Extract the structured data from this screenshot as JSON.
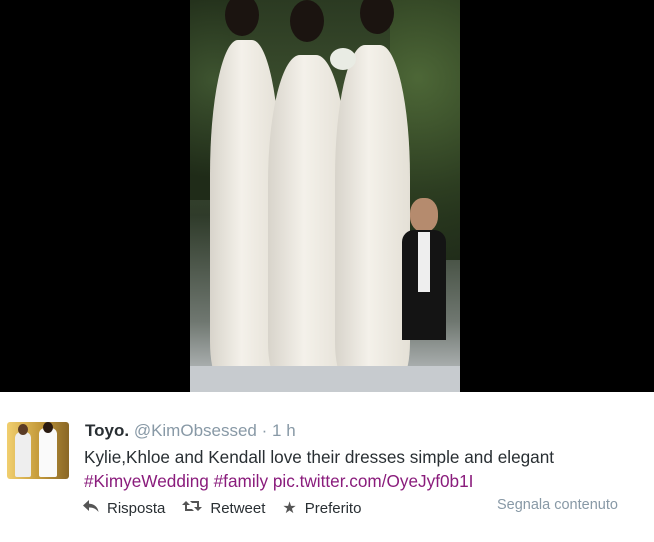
{
  "tweet": {
    "display_name": "Toyo.",
    "handle": "@KimObsessed",
    "separator": "·",
    "time": "1 h",
    "text": "Kylie,Khloe and Kendall love their dresses simple and elegant",
    "hashtags": [
      "#KimyeWedding",
      "#family"
    ],
    "link": "pic.twitter.com/OyeJyf0b1I",
    "actions": {
      "reply": "Risposta",
      "retweet": "Retweet",
      "favorite": "Preferito",
      "report": "Segnala contenuto"
    },
    "icons": {
      "reply": "reply-icon",
      "retweet": "retweet-icon",
      "favorite": "star-icon"
    },
    "colors": {
      "hashtag": "#8a1c7c",
      "meta": "#8899a6",
      "text": "#292f33"
    }
  }
}
